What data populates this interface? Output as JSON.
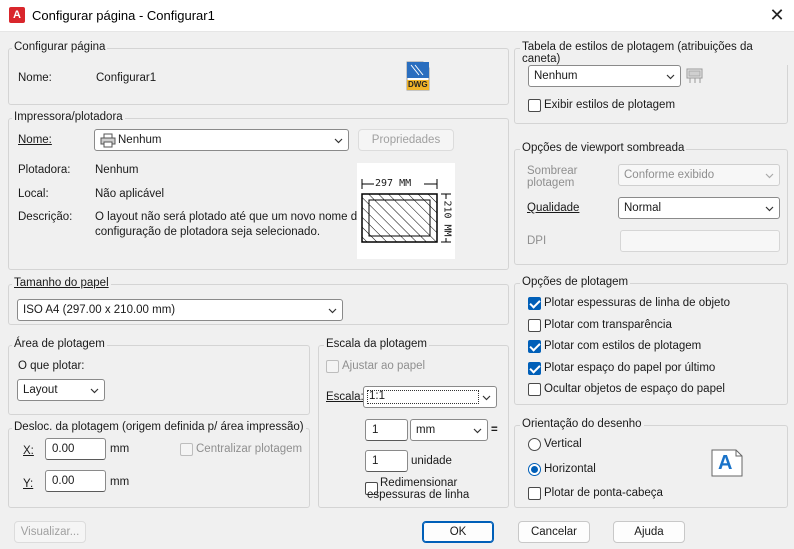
{
  "window": {
    "title": "Configurar página - Configurar1",
    "app_icon_letter": "A",
    "close_glyph": "✕"
  },
  "page_setup": {
    "group_title": "Configurar página",
    "name_label": "Nome:",
    "name_value": "Configurar1",
    "dwg_badge": "DWG"
  },
  "printer": {
    "group_title": "Impressora/plotadora",
    "name_label": "Nome:",
    "selected": "Nenhum",
    "properties_button": "Propriedades",
    "plotter_label": "Plotadora:",
    "plotter_value": "Nenhum",
    "location_label": "Local:",
    "location_value": "Não aplicável",
    "description_label": "Descrição:",
    "description_line1": "O layout não será plotado até que um novo nome de",
    "description_line2": "configuração de plotadora seja selecionado.",
    "preview_width": "297 MM",
    "preview_height": "210 MM"
  },
  "paper_size": {
    "group_title": "Tamanho do papel",
    "selected": "ISO A4 (297.00 x 210.00 mm)"
  },
  "plot_area": {
    "group_title": "Área de plotagem",
    "what_label": "O que plotar:",
    "selected": "Layout"
  },
  "plot_offset": {
    "group_title": "Desloc. da plotagem (origem definida p/ área impressão)",
    "x_label": "X:",
    "x_value": "0.00",
    "x_unit": "mm",
    "y_label": "Y:",
    "y_value": "0.00",
    "y_unit": "mm",
    "center_label": "Centralizar plotagem"
  },
  "plot_scale": {
    "group_title": "Escala da plotagem",
    "fit_label": "Ajustar ao papel",
    "scale_label": "Escala:",
    "scale_value": "1:1",
    "mm_value": "1",
    "mm_unit": "mm",
    "equals": "=",
    "unit_value": "1",
    "unit_label": "unidade",
    "scale_lineweights_line1": "Redimensionar",
    "scale_lineweights_line2": "espessuras de linha"
  },
  "plot_style_table": {
    "group_title": "Tabela de estilos de plotagem (atribuições da caneta)",
    "selected": "Nenhum",
    "display_label": "Exibir estilos de plotagem"
  },
  "shaded_viewport": {
    "group_title": "Opções de viewport sombreada",
    "shade_label_line1": "Sombrear",
    "shade_label_line2": "plotagem",
    "shade_value": "Conforme exibido",
    "quality_label": "Qualidade",
    "quality_value": "Normal",
    "dpi_label": "DPI",
    "dpi_value": ""
  },
  "plot_options": {
    "group_title": "Opções de plotagem",
    "items": [
      {
        "label": "Plotar espessuras de linha de objeto",
        "checked": true
      },
      {
        "label": "Plotar com transparência",
        "checked": false
      },
      {
        "label": "Plotar com estilos de plotagem",
        "checked": true
      },
      {
        "label": "Plotar espaço do papel por último",
        "checked": true
      },
      {
        "label": "Ocultar objetos de espaço do papel",
        "checked": false
      }
    ]
  },
  "drawing_orientation": {
    "group_title": "Orientação do desenho",
    "portrait": "Vertical",
    "landscape": "Horizontal",
    "upside_down": "Plotar de ponta-cabeça",
    "selected": "Horizontal",
    "icon_letter": "A"
  },
  "footer": {
    "preview": "Visualizar...",
    "ok": "OK",
    "cancel": "Cancelar",
    "help": "Ajuda"
  },
  "colors": {
    "accent": "#005fb8",
    "autocad_red": "#d9262c"
  }
}
